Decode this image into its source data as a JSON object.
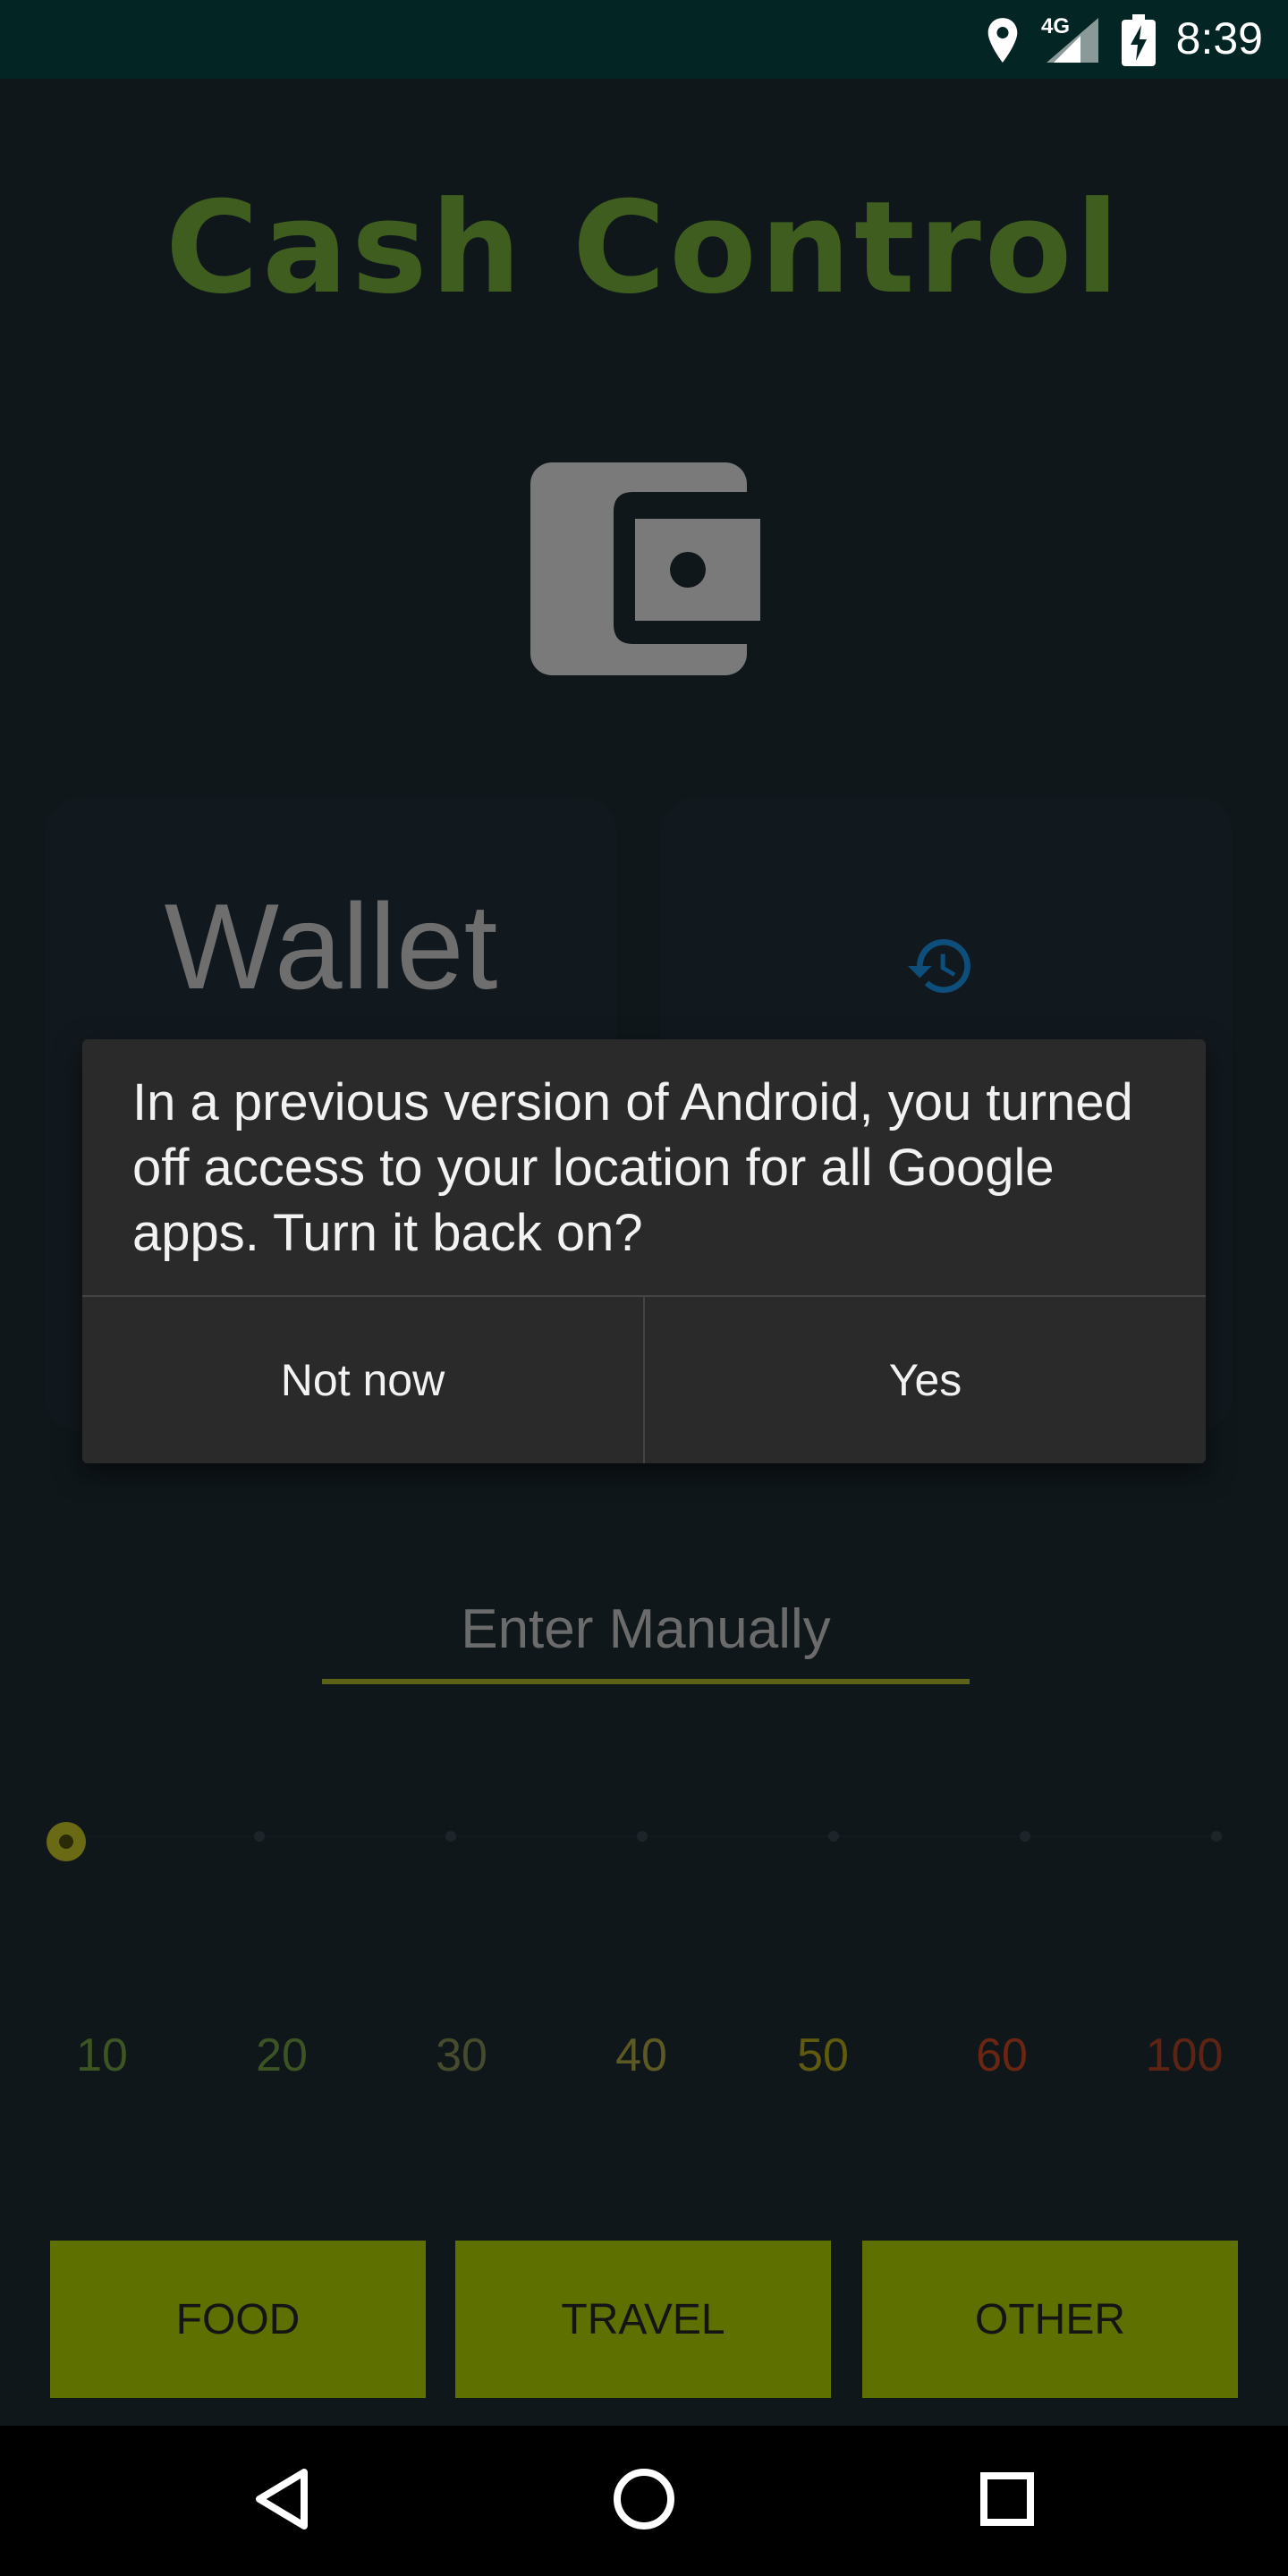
{
  "status_bar": {
    "time": "8:39",
    "network": "4G",
    "icons": [
      "location-icon",
      "signal-icon",
      "battery-charging-icon"
    ]
  },
  "app": {
    "title": "Cash Control",
    "logo_icon": "wallet-icon"
  },
  "cards": {
    "left_title": "Wallet",
    "right_icon": "history-icon"
  },
  "dialog": {
    "message": "In a previous version of Android, you turned off access to your location for all Google apps. Turn it back on?",
    "negative_label": "Not now",
    "positive_label": "Yes"
  },
  "manual_entry": {
    "placeholder": "Enter Manually",
    "value": ""
  },
  "slider": {
    "selected_value": 10,
    "ticks": [
      {
        "label": "10",
        "color": "#3d5522"
      },
      {
        "label": "20",
        "color": "#3c5424"
      },
      {
        "label": "30",
        "color": "#464b2e"
      },
      {
        "label": "40",
        "color": "#5c5a22"
      },
      {
        "label": "50",
        "color": "#5f5a10"
      },
      {
        "label": "60",
        "color": "#6a2612"
      },
      {
        "label": "100",
        "color": "#5d2414"
      }
    ]
  },
  "categories": {
    "food": "FOOD",
    "travel": "TRAVEL",
    "other": "OTHER"
  },
  "nav_bar": {
    "icons": [
      "back-icon",
      "home-icon",
      "recents-icon"
    ]
  },
  "colors": {
    "title": "#3f5d1f",
    "category_button": "#5d7000",
    "input_underline": "#5e6118",
    "history_accent": "#0d4f7a"
  }
}
